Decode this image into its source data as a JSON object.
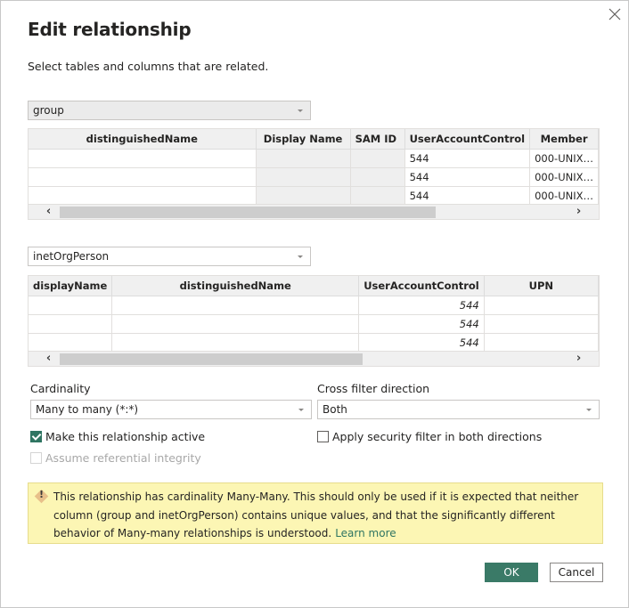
{
  "dialog": {
    "title": "Edit relationship",
    "subtitle": "Select tables and columns that are related.",
    "close_icon": "close-icon"
  },
  "table1": {
    "selected": "group",
    "columns": [
      "distinguishedName",
      "Display Name",
      "SAM ID",
      "UserAccountControl",
      "Member"
    ],
    "rows": [
      [
        "",
        "",
        "",
        "544",
        "000-UNIX…"
      ],
      [
        "",
        "",
        "",
        "544",
        "000-UNIX…"
      ],
      [
        "",
        "",
        "",
        "544",
        "000-UNIX…"
      ]
    ],
    "scroll_left_icon": "chevron-left-icon",
    "scroll_right_icon": "chevron-right-icon"
  },
  "table2": {
    "selected": "inetOrgPerson",
    "columns": [
      "displayName",
      "distinguishedName",
      "UserAccountControl",
      "UPN"
    ],
    "rows": [
      [
        "",
        "",
        "544",
        ""
      ],
      [
        "",
        "",
        "544",
        ""
      ],
      [
        "",
        "",
        "544",
        ""
      ]
    ]
  },
  "cardinality": {
    "label": "Cardinality",
    "selected": "Many to many (*:*)"
  },
  "cross_filter": {
    "label": "Cross filter direction",
    "selected": "Both"
  },
  "options": {
    "active": {
      "label": "Make this relationship active",
      "checked": true
    },
    "referential": {
      "label": "Assume referential integrity",
      "checked": false,
      "disabled": true
    },
    "security": {
      "label": "Apply security filter in both directions",
      "checked": false
    }
  },
  "warning": {
    "icon": "warning-icon",
    "text": "This relationship has cardinality Many-Many. This should only be used if it is expected that neither column (group and inetOrgPerson) contains unique values, and that the significantly different behavior of Many-many relationships is understood.",
    "link": "Learn more"
  },
  "buttons": {
    "ok": "OK",
    "cancel": "Cancel"
  },
  "colors": {
    "accent": "#3a7a67",
    "warning_bg": "#fcf6b4"
  }
}
